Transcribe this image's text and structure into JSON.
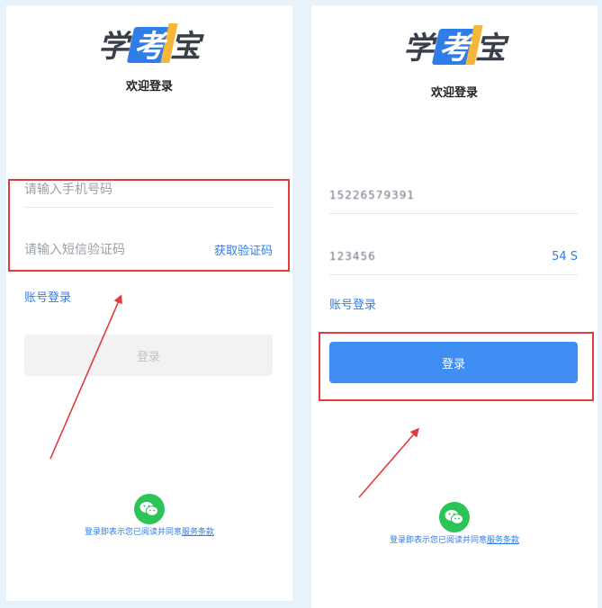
{
  "brand": {
    "logo_left": "学",
    "logo_mid": "考",
    "logo_right": "宝"
  },
  "left": {
    "welcome": "欢迎登录",
    "phone_placeholder": "请输入手机号码",
    "code_placeholder": "请输入短信验证码",
    "get_code": "获取验证码",
    "account_login": "账号登录",
    "login": "登录",
    "agree_prefix": "登录即表示您已阅读并同意",
    "agree_terms": "服务条款"
  },
  "right": {
    "welcome": "欢迎登录",
    "phone_value": "15226579391",
    "code_value": "123456",
    "countdown": "54 S",
    "account_login": "账号登录",
    "login": "登录",
    "agree_prefix": "登录即表示您已阅读并同意",
    "agree_terms": "服务条款"
  },
  "colors": {
    "accent": "#2f7de8",
    "button_active": "#3f8ef4",
    "highlight": "#e23b3b",
    "wechat": "#2cc357"
  }
}
